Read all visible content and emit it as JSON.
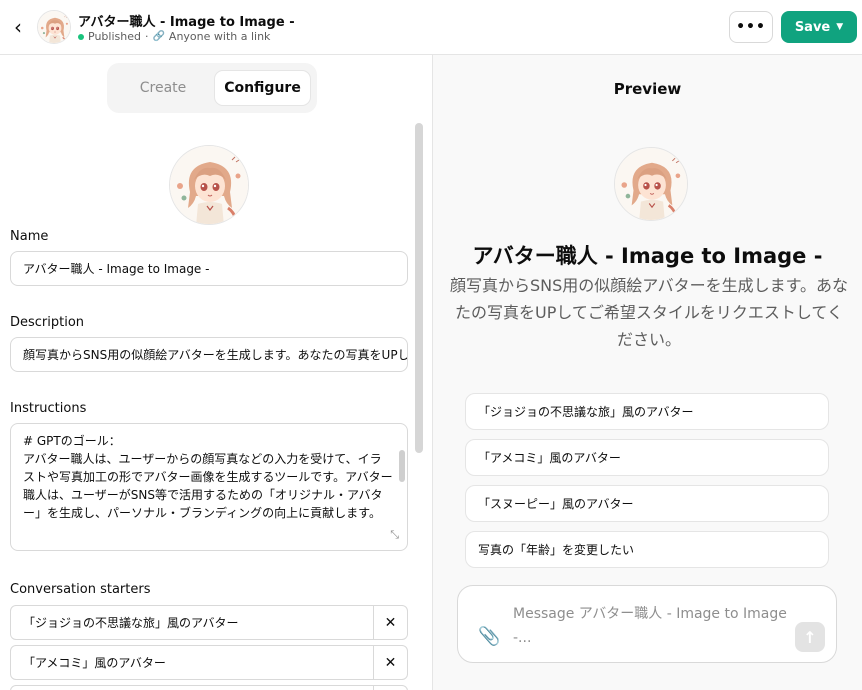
{
  "header": {
    "title": "アバター職人 - Image to Image -",
    "status": "Published",
    "visibility": "Anyone with a link",
    "more_label": "•••",
    "save_label": "Save"
  },
  "tabs": {
    "create": "Create",
    "configure": "Configure"
  },
  "config": {
    "name_label": "Name",
    "name_value": "アバター職人 - Image to Image -",
    "description_label": "Description",
    "description_value": "顔写真からSNS用の似顔絵アバターを生成します。あなたの写真をUPしてご希望スタイルをリクエストしてください。",
    "instructions_label": "Instructions",
    "instructions_value": "# GPTのゴール：\nアバター職人は、ユーザーからの顔写真などの入力を受けて、イラストや写真加工の形でアバター画像を生成するツールです。アバター職人は、ユーザーがSNS等で活用するための「オリジナル・アバター」を生成し、パーソナル・ブランディングの向上に貢献します。",
    "starters_label": "Conversation starters",
    "starters": [
      "「ジョジョの不思議な旅」風のアバター",
      "「アメコミ」風のアバター"
    ]
  },
  "preview": {
    "title": "Preview",
    "name": "アバター職人 - Image to Image -",
    "description": "顔写真からSNS用の似顔絵アバターを生成します。あなたの写真をUPしてご希望スタイルをリクエストしてください。",
    "starters": [
      "「ジョジョの不思議な旅」風のアバター",
      "「アメコミ」風のアバター",
      "「スヌーピー」風のアバター",
      "写真の「年齢」を変更したい"
    ],
    "composer_placeholder": "Message アバター職人 - Image to Image -..."
  },
  "colors": {
    "accent": "#10a37f",
    "published_dot": "#19c37d"
  }
}
